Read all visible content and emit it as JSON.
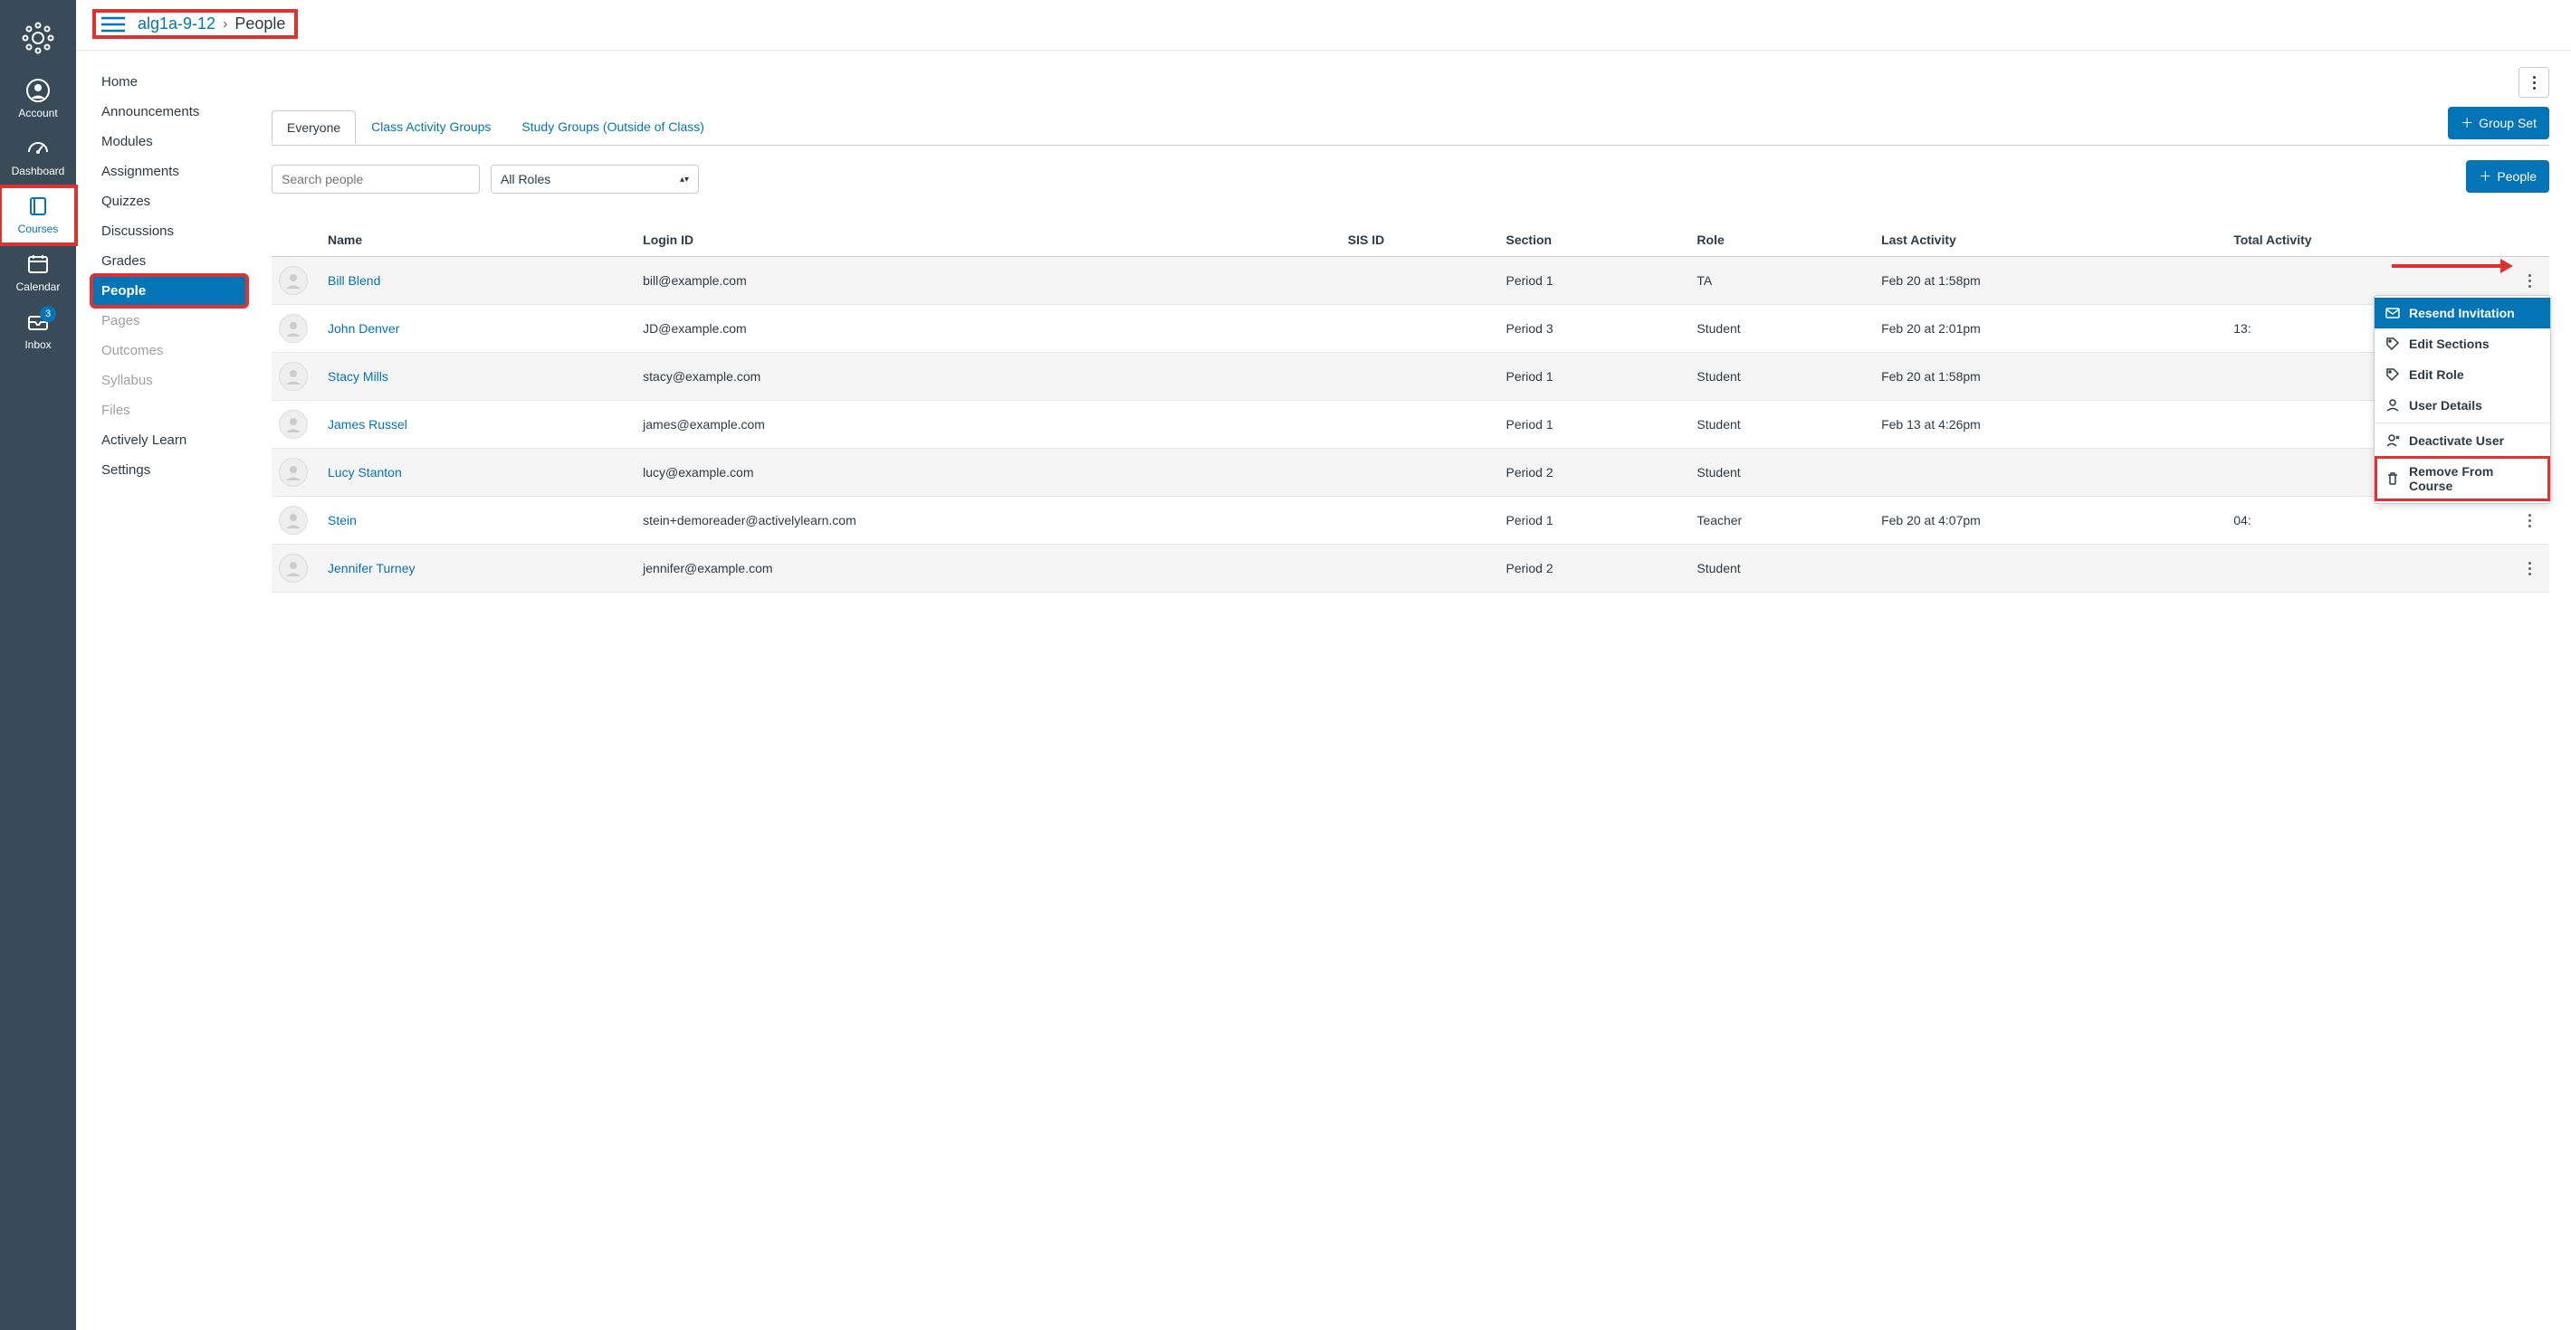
{
  "global_nav": {
    "items": [
      {
        "label": "Account",
        "icon": "account"
      },
      {
        "label": "Dashboard",
        "icon": "dashboard"
      },
      {
        "label": "Courses",
        "icon": "courses",
        "active": true,
        "highlight": true
      },
      {
        "label": "Calendar",
        "icon": "calendar"
      },
      {
        "label": "Inbox",
        "icon": "inbox",
        "badge": "3"
      }
    ]
  },
  "breadcrumb": {
    "course": "alg1a-9-12",
    "current": "People"
  },
  "course_nav": {
    "items": [
      {
        "label": "Home"
      },
      {
        "label": "Announcements"
      },
      {
        "label": "Modules"
      },
      {
        "label": "Assignments"
      },
      {
        "label": "Quizzes"
      },
      {
        "label": "Discussions"
      },
      {
        "label": "Grades"
      },
      {
        "label": "People",
        "active": true
      },
      {
        "label": "Pages",
        "disabled": true
      },
      {
        "label": "Outcomes",
        "disabled": true
      },
      {
        "label": "Syllabus",
        "disabled": true
      },
      {
        "label": "Files",
        "disabled": true
      },
      {
        "label": "Actively Learn"
      },
      {
        "label": "Settings"
      }
    ]
  },
  "tabs": {
    "items": [
      {
        "label": "Everyone",
        "active": true
      },
      {
        "label": "Class Activity Groups"
      },
      {
        "label": "Study Groups (Outside of Class)"
      }
    ]
  },
  "buttons": {
    "group_set": "Group Set",
    "people": "People"
  },
  "filters": {
    "search_placeholder": "Search people",
    "roles_label": "All Roles"
  },
  "table": {
    "headers": {
      "name": "Name",
      "login_id": "Login ID",
      "sis_id": "SIS ID",
      "section": "Section",
      "role": "Role",
      "last_activity": "Last Activity",
      "total_activity": "Total Activity"
    },
    "rows": [
      {
        "name": "Bill Blend",
        "login_id": "bill@example.com",
        "sis_id": "",
        "section": "Period 1",
        "role": "TA",
        "last_activity": "Feb 20 at 1:58pm",
        "total_activity": "",
        "menu_open": true
      },
      {
        "name": "John Denver",
        "login_id": "JD@example.com",
        "sis_id": "",
        "section": "Period 3",
        "role": "Student",
        "last_activity": "Feb 20 at 2:01pm",
        "total_activity": "13:"
      },
      {
        "name": "Stacy Mills",
        "login_id": "stacy@example.com",
        "sis_id": "",
        "section": "Period 1",
        "role": "Student",
        "last_activity": "Feb 20 at 1:58pm",
        "total_activity": ""
      },
      {
        "name": "James Russel",
        "login_id": "james@example.com",
        "sis_id": "",
        "section": "Period 1",
        "role": "Student",
        "last_activity": "Feb 13 at 4:26pm",
        "total_activity": ""
      },
      {
        "name": "Lucy Stanton",
        "login_id": "lucy@example.com",
        "sis_id": "",
        "section": "Period 2",
        "role": "Student",
        "last_activity": "",
        "total_activity": ""
      },
      {
        "name": "Stein",
        "login_id": "stein+demoreader@activelylearn.com",
        "sis_id": "",
        "section": "Period 1",
        "role": "Teacher",
        "last_activity": "Feb 20 at 4:07pm",
        "total_activity": "04:"
      },
      {
        "name": "Jennifer Turney",
        "login_id": "jennifer@example.com",
        "sis_id": "",
        "section": "Period 2",
        "role": "Student",
        "last_activity": "",
        "total_activity": ""
      }
    ]
  },
  "row_menu": {
    "items": [
      {
        "label": "Resend Invitation",
        "icon": "mail",
        "selected": true
      },
      {
        "label": "Edit Sections",
        "icon": "tag"
      },
      {
        "label": "Edit Role",
        "icon": "tag"
      },
      {
        "label": "User Details",
        "icon": "user"
      },
      {
        "label": "Deactivate User",
        "icon": "user-x",
        "divider_before": true
      },
      {
        "label": "Remove From Course",
        "icon": "trash",
        "highlight": true
      }
    ]
  }
}
